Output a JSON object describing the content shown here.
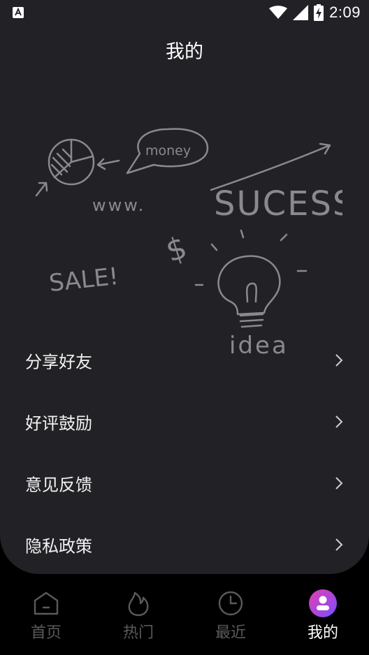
{
  "status_bar": {
    "time": "2:09",
    "icons": [
      "a-notification-icon",
      "wifi-icon",
      "signal-icon",
      "battery-charging-icon"
    ]
  },
  "header": {
    "title": "我的"
  },
  "illustration": {
    "texts": {
      "money": "money",
      "www": "www.",
      "success": "SUCESS",
      "dollar": "$",
      "sale": "SALE!",
      "idea": "idea"
    },
    "stroke_color": "#8a8a8e"
  },
  "menu": {
    "items": [
      {
        "label": "分享好友",
        "icon": "chevron-right-icon"
      },
      {
        "label": "好评鼓励",
        "icon": "chevron-right-icon"
      },
      {
        "label": "意见反馈",
        "icon": "chevron-right-icon"
      },
      {
        "label": "隐私政策",
        "icon": "chevron-right-icon"
      }
    ]
  },
  "tabs": [
    {
      "label": "首页",
      "icon": "home-icon",
      "active": false
    },
    {
      "label": "热门",
      "icon": "flame-icon",
      "active": false
    },
    {
      "label": "最近",
      "icon": "clock-icon",
      "active": false
    },
    {
      "label": "我的",
      "icon": "profile-icon",
      "active": true
    }
  ],
  "colors": {
    "background": "#000000",
    "card": "#222226",
    "inactive": "#5a5a5e",
    "accent_gradient": [
      "#e040b0",
      "#7c4dff"
    ]
  }
}
